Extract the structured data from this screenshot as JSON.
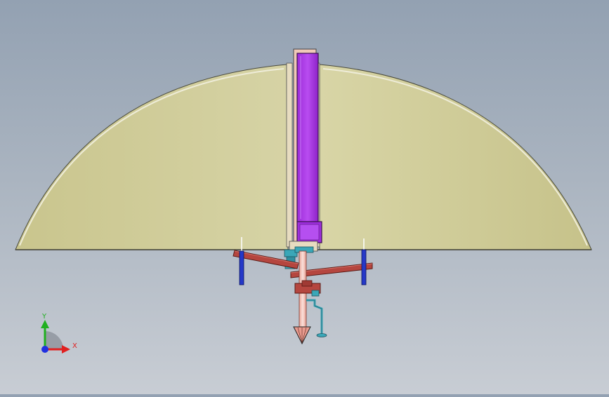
{
  "viewport": {
    "background_top": "#93a1b2",
    "background_bottom": "#c8cdd4"
  },
  "model": {
    "dome_fill": "#cfcb96",
    "dome_edge": "#e9e7cf",
    "mast_color": "#a833e6",
    "arm_color": "#b5463f",
    "rod_color": "#2538c8",
    "tube_color": "#f3c7bf",
    "fitting_color": "#3aa7b8"
  },
  "triad": {
    "x_label": "X",
    "y_label": "Y",
    "x_color": "#e02020",
    "y_color": "#20b020",
    "z_color": "#2030e0",
    "origin_icon": "triad-origin-icon"
  }
}
